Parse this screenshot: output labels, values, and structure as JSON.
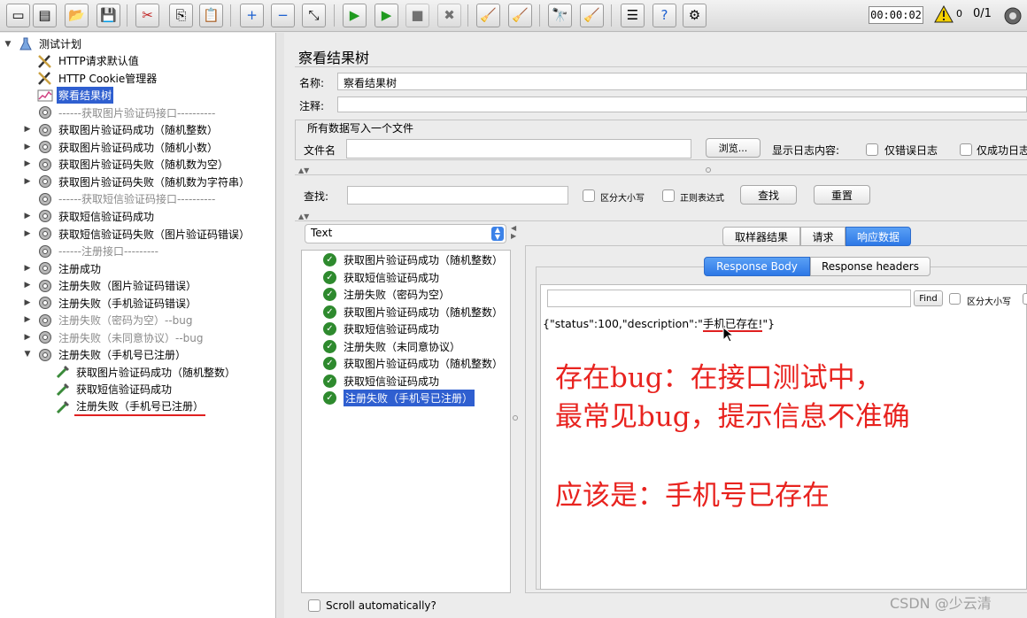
{
  "toolbar": {
    "buttons": [
      {
        "name": "new-icon",
        "glyph": "▭"
      },
      {
        "name": "templates-icon",
        "glyph": "▤"
      },
      {
        "name": "open-icon",
        "glyph": "📂"
      },
      {
        "name": "save-icon",
        "glyph": "💾"
      },
      {
        "name": "cut-icon",
        "glyph": "✂"
      },
      {
        "name": "copy-icon",
        "glyph": "⎘"
      },
      {
        "name": "paste-icon",
        "glyph": "📋"
      },
      {
        "name": "expand-icon",
        "glyph": "+"
      },
      {
        "name": "collapse-icon",
        "glyph": "−"
      },
      {
        "name": "toggle-icon",
        "glyph": "⤡"
      },
      {
        "name": "start-icon",
        "glyph": "▶"
      },
      {
        "name": "start-no-pause-icon",
        "glyph": "▶"
      },
      {
        "name": "stop-icon",
        "glyph": "■"
      },
      {
        "name": "shutdown-icon",
        "glyph": "✖"
      },
      {
        "name": "clear-icon",
        "glyph": "🧹"
      },
      {
        "name": "clear-all-icon",
        "glyph": "🧹"
      },
      {
        "name": "search-binoculars-icon",
        "glyph": "🔭"
      },
      {
        "name": "reset-search-icon",
        "glyph": "🧹"
      },
      {
        "name": "function-helper-icon",
        "glyph": "☰"
      },
      {
        "name": "help-icon",
        "glyph": "?"
      },
      {
        "name": "remote-icon",
        "glyph": "⚙"
      }
    ],
    "timer": "00:00:02",
    "warning_count": "0",
    "thread_count": "0/1"
  },
  "tree": {
    "root": "测试计划",
    "items": [
      {
        "label": "HTTP请求默认值",
        "icon": "wrench-icon"
      },
      {
        "label": "HTTP Cookie管理器",
        "icon": "wrench-icon"
      },
      {
        "label": "察看结果树",
        "icon": "chart-icon"
      },
      {
        "label": "------获取图片验证码接口----------",
        "icon": "gear-icon"
      },
      {
        "label": "获取图片验证码成功（随机整数）",
        "icon": "gear-icon"
      },
      {
        "label": "获取图片验证码成功（随机小数）",
        "icon": "gear-icon"
      },
      {
        "label": "获取图片验证码失败（随机数为空）",
        "icon": "gear-icon"
      },
      {
        "label": "获取图片验证码失败（随机数为字符串）",
        "icon": "gear-icon"
      },
      {
        "label": "------获取短信验证码接口----------",
        "icon": "gear-icon"
      },
      {
        "label": "获取短信验证码成功",
        "icon": "gear-icon"
      },
      {
        "label": "获取短信验证码失败（图片验证码错误）",
        "icon": "gear-icon"
      },
      {
        "label": "------注册接口---------",
        "icon": "gear-icon"
      },
      {
        "label": "注册成功",
        "icon": "gear-icon"
      },
      {
        "label": "注册失败（图片验证码错误）",
        "icon": "gear-icon"
      },
      {
        "label": "注册失败（手机验证码错误）",
        "icon": "gear-icon"
      },
      {
        "label": "注册失败（密码为空）--bug",
        "icon": "gear-icon"
      },
      {
        "label": "注册失败（未同意协议）--bug",
        "icon": "gear-icon"
      },
      {
        "label": "注册失败（手机号已注册）",
        "icon": "gear-icon"
      },
      {
        "label": "获取图片验证码成功（随机整数）",
        "icon": "sampler-icon"
      },
      {
        "label": "获取短信验证码成功",
        "icon": "sampler-icon"
      },
      {
        "label": "注册失败（手机号已注册）",
        "icon": "sampler-icon"
      }
    ]
  },
  "panel": {
    "title": "察看结果树",
    "name_label": "名称:",
    "name_value": "察看结果树",
    "comment_label": "注释:",
    "file_section": "所有数据写入一个文件",
    "filename_label": "文件名",
    "browse_label": "浏览...",
    "log_label": "显示日志内容:",
    "errors_only_label": "仅错误日志",
    "success_only_label": "仅成功日志",
    "search_label": "查找:",
    "case_label": "区分大小写",
    "regex_label": "正则表达式",
    "search_button": "查找",
    "reset_button": "重置",
    "renderer_value": "Text"
  },
  "results": [
    "获取图片验证码成功（随机整数）",
    "获取短信验证码成功",
    "注册失败（密码为空）",
    "获取图片验证码成功（随机整数）",
    "获取短信验证码成功",
    "注册失败（未同意协议）",
    "获取图片验证码成功（随机整数）",
    "获取短信验证码成功",
    "注册失败（手机号已注册）"
  ],
  "tabs": {
    "main": [
      "取样器结果",
      "请求",
      "响应数据"
    ],
    "sub": [
      "Response Body",
      "Response headers"
    ]
  },
  "response": {
    "find_label": "Find",
    "case_label": "区分大小写",
    "body_prefix": "{\"status\":100,\"description\":\"",
    "body_highlight": "手机已存在!",
    "body_suffix": "\"}"
  },
  "scroll_label": "Scroll automatically?",
  "annotation": {
    "line1": "存在bug：在接口测试中，",
    "line2": "最常见bug，提示信息不准确",
    "line3": "应该是：手机号已存在"
  },
  "watermark": "CSDN @少云清",
  "colors": {
    "accent": "#2d78e6",
    "annotation": "#e8231f",
    "selection": "#2f5fd0"
  }
}
